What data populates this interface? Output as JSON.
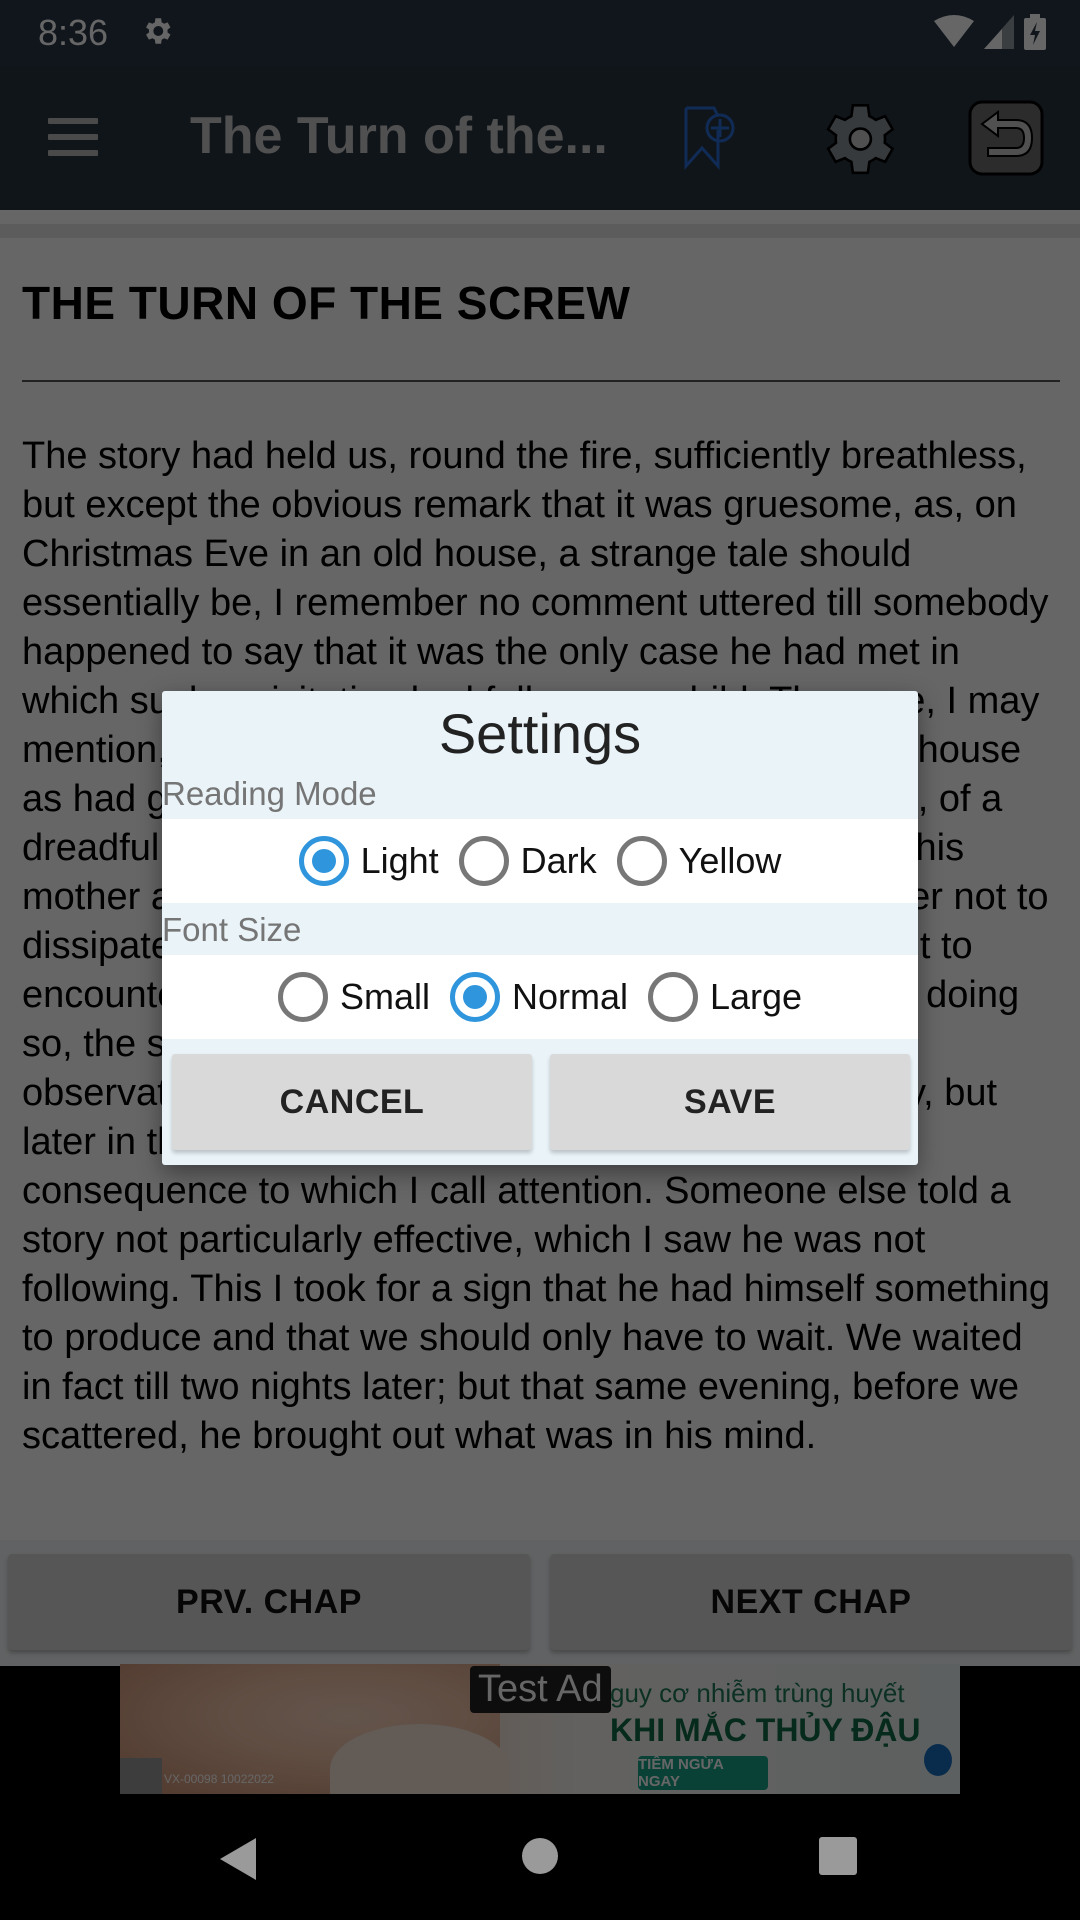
{
  "status_bar": {
    "time": "8:36",
    "icons": [
      "settings-gear-icon",
      "wifi-icon",
      "cellular-signal-icon",
      "battery-charging-icon"
    ]
  },
  "app_bar": {
    "title": "The Turn of the...",
    "icons": [
      "menu-icon",
      "add-bookmark-icon",
      "settings-icon",
      "back-icon"
    ],
    "bookmark_color": "#1e5aa8"
  },
  "content": {
    "chapter_title": "THE TURN OF THE SCREW",
    "paragraph": "The story had held us, round the fire, sufficiently breathless, but except the obvious remark that it was gruesome, as, on Christmas Eve in an old house, a strange tale should essentially be, I remember no comment uttered till somebody happened to say that it was the only case he had met in which such a visitation had fallen on a child. The case, I may mention, was that of an apparition in just such an old house as had gathered us for the occasion—an appearance, of a dreadful kind, to a little boy sleeping in the room with his mother and waking her up in the terror of it; waking her not to dissipate his dread and soothe him to sleep again, but to encounter also, herself, before she had succeeded in doing so, the same sight that had shaken him. It was this observation that drew from Douglas—not immediately, but later in the evening—a reply that had the interesting consequence to which I call attention. Someone else told a story not particularly effective, which I saw he was not following. This I took for a sign that he had himself something to produce and that we should only have to wait. We waited in fact till two nights later; but that same evening, before we scattered, he brought out what was in his mind."
  },
  "chapter_nav": {
    "prev_label": "PRV. CHAP",
    "next_label": "NEXT CHAP"
  },
  "ad": {
    "badge": "Test Ad",
    "line1": "guy cơ nhiễm trùng huyết",
    "line2": "KHI MẮC THỦY ĐẬU",
    "cta": "TIÊM NGỪA NGAY",
    "code": "VX-00098 10022022"
  },
  "settings_dialog": {
    "title": "Settings",
    "reading_mode": {
      "label": "Reading Mode",
      "options": [
        "Light",
        "Dark",
        "Yellow"
      ],
      "selected": "Light"
    },
    "font_size": {
      "label": "Font Size",
      "options": [
        "Small",
        "Normal",
        "Large"
      ],
      "selected": "Normal"
    },
    "cancel_label": "CANCEL",
    "save_label": "SAVE",
    "accent_color": "#2f95dc"
  },
  "system_nav": {
    "icons": [
      "back-triangle-icon",
      "home-circle-icon",
      "recents-square-icon"
    ]
  }
}
